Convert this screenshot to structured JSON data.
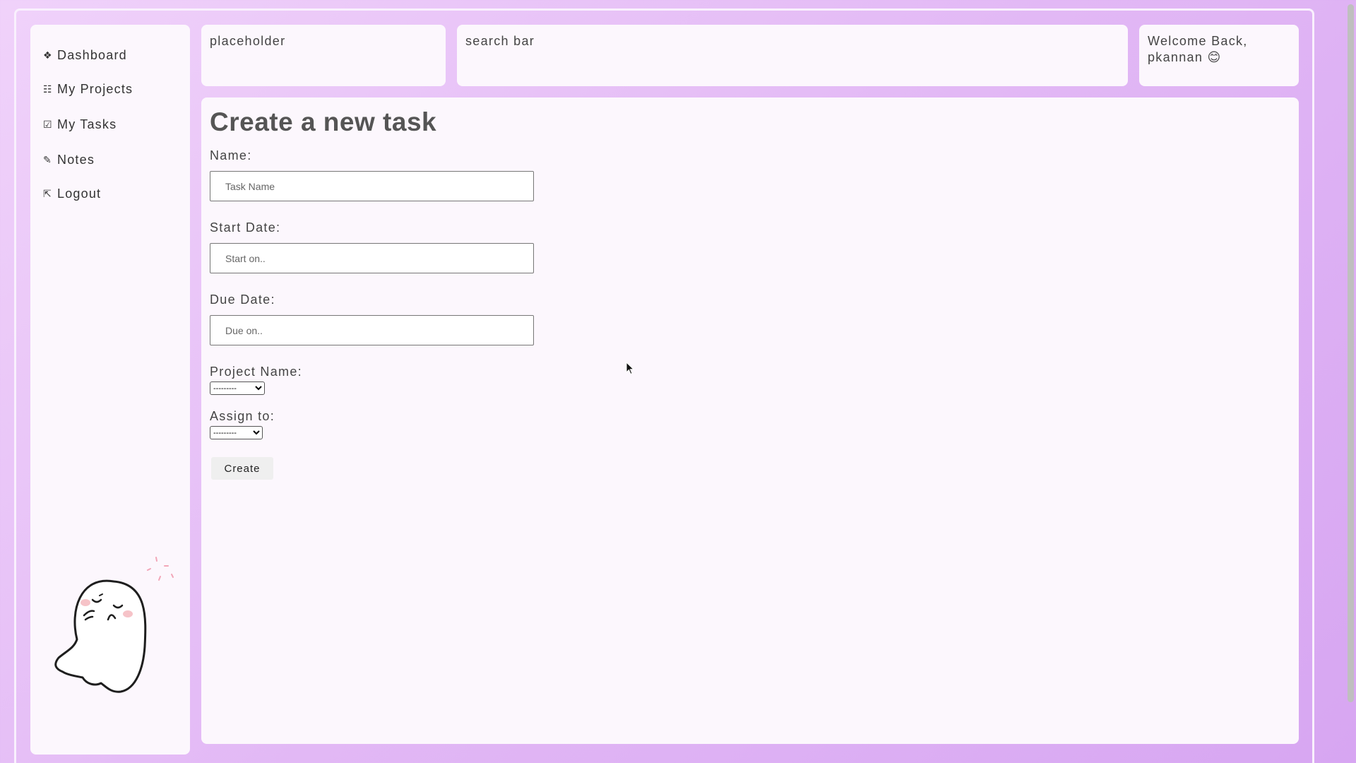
{
  "sidebar": {
    "items": [
      {
        "icon": "diamond-icon",
        "glyph": "❖",
        "label": "Dashboard"
      },
      {
        "icon": "list-icon",
        "glyph": "☷",
        "label": "My Projects"
      },
      {
        "icon": "checkbox-icon",
        "glyph": "☑",
        "label": "My Tasks"
      },
      {
        "icon": "pencil-icon",
        "glyph": "✎",
        "label": "Notes"
      },
      {
        "icon": "logout-icon",
        "glyph": "⇱",
        "label": "Logout"
      }
    ]
  },
  "header": {
    "placeholder_text": "placeholder",
    "search_text": "search bar",
    "welcome_text": "Welcome Back,",
    "username": "pkannan",
    "emoji": "😊"
  },
  "form": {
    "title": "Create a new task",
    "name_label": "Name:",
    "name_placeholder": "Task Name",
    "start_label": "Start Date:",
    "start_placeholder": "Start on..",
    "due_label": "Due Date:",
    "due_placeholder": "Due on..",
    "project_label": "Project Name:",
    "project_selected": "---------",
    "assign_label": "Assign to:",
    "assign_selected": "---------",
    "create_label": "Create"
  },
  "colors": {
    "background": "#e2b8f5",
    "panel": "#fcf7fd",
    "text": "#444444"
  }
}
